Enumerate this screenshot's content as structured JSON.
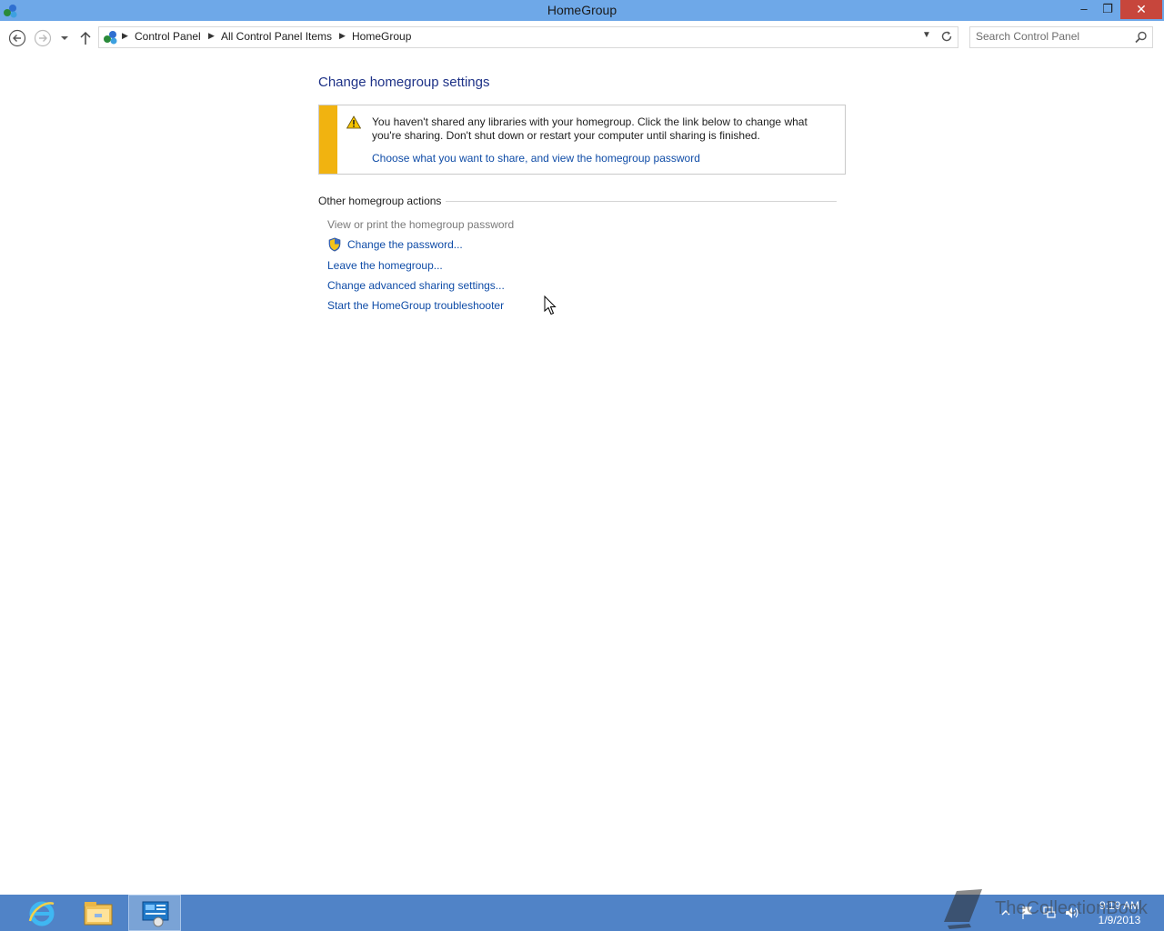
{
  "window": {
    "title": "HomeGroup",
    "minimize_glyph": "–",
    "maximize_glyph": "❐",
    "close_glyph": "✕"
  },
  "nav": {
    "breadcrumbs": [
      "Control Panel",
      "All Control Panel Items",
      "HomeGroup"
    ],
    "search_placeholder": "Search Control Panel",
    "icons": [
      "back-icon",
      "forward-icon",
      "recent-dropdown-icon",
      "up-icon",
      "refresh-icon",
      "search-icon"
    ]
  },
  "content": {
    "title": "Change homegroup settings",
    "warning": {
      "message": "You haven't shared any libraries with your homegroup. Click the link below to change what you're sharing. Don't shut down or restart your computer until sharing is finished.",
      "link": "Choose what you want to share, and view the homegroup password",
      "stripe_color": "#f1b310"
    },
    "section_heading": "Other homegroup actions",
    "actions": [
      {
        "label": "View or print the homegroup password",
        "enabled": false
      },
      {
        "label": "Change the password...",
        "enabled": true,
        "icon": "uac-shield-icon"
      },
      {
        "label": "Leave the homegroup...",
        "enabled": true
      },
      {
        "label": "Change advanced sharing settings...",
        "enabled": true
      },
      {
        "label": "Start the HomeGroup troubleshooter",
        "enabled": true
      }
    ]
  },
  "taskbar": {
    "items": [
      "internet-explorer-icon",
      "file-explorer-icon",
      "control-panel-icon"
    ],
    "tray_icons": [
      "show-hidden-icons-chevron",
      "action-center-flag-icon",
      "network-icon",
      "volume-icon"
    ],
    "time": "9:19 AM",
    "date": "1/9/2013",
    "watermark": "TheCollectionBook"
  },
  "colors": {
    "titlebar": "#6ea8e8",
    "taskbar": "#5083c7",
    "link": "#0f4ca7",
    "heading": "#1e3287",
    "close_button": "#c7463c"
  }
}
